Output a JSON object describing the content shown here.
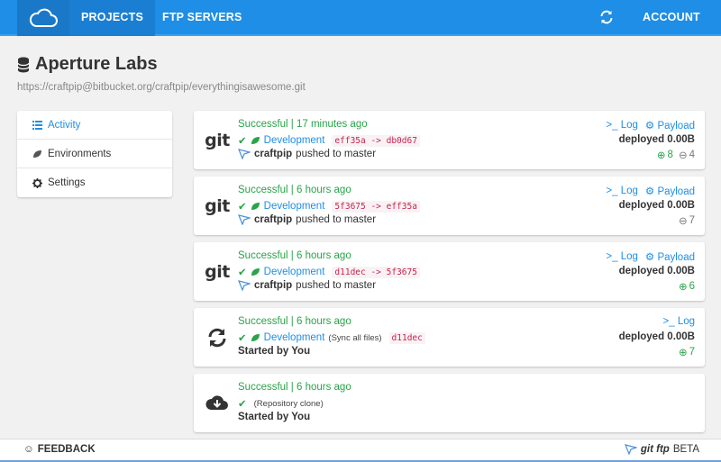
{
  "nav": {
    "projects": "PROJECTS",
    "ftp_servers": "FTP SERVERS",
    "account": "ACCOUNT"
  },
  "project": {
    "title": "Aperture Labs",
    "url": "https://craftpip@bitbucket.org/craftpip/everythingisawesome.git"
  },
  "sidebar": {
    "items": [
      {
        "label": "Activity",
        "icon": "list-icon"
      },
      {
        "label": "Environments",
        "icon": "leaf-icon"
      },
      {
        "label": "Settings",
        "icon": "gear-icon"
      }
    ]
  },
  "activity": [
    {
      "status": "Successful | 17 minutes ago",
      "environment": "Development",
      "hash": "eff35a -> db0d67",
      "user": "craftpip",
      "action": "pushed to master",
      "log": "Log",
      "payload": "Payload",
      "deployed": "deployed 0.00B",
      "added": "8",
      "removed": "4"
    },
    {
      "status": "Successful | 6 hours ago",
      "environment": "Development",
      "hash": "5f3675 -> eff35a",
      "user": "craftpip",
      "action": "pushed to master",
      "log": "Log",
      "payload": "Payload",
      "deployed": "deployed 0.00B",
      "removed": "7"
    },
    {
      "status": "Successful | 6 hours ago",
      "environment": "Development",
      "hash": "d11dec -> 5f3675",
      "user": "craftpip",
      "action": "pushed to master",
      "log": "Log",
      "payload": "Payload",
      "deployed": "deployed 0.00B",
      "added": "6"
    },
    {
      "status": "Successful | 6 hours ago",
      "environment": "Development",
      "note": "(Sync all files)",
      "hash": "d11dec",
      "started": "Started by You",
      "log": "Log",
      "deployed": "deployed 0.00B",
      "added": "7"
    },
    {
      "status": "Successful | 6 hours ago",
      "note": "(Repository clone)",
      "started": "Started by You"
    }
  ],
  "footer": {
    "feedback": "FEEDBACK",
    "brand": "git ftp",
    "beta": "BETA"
  },
  "colors": {
    "primary": "#1e8ee6",
    "success": "#2aa34a",
    "hash": "#c7254e"
  }
}
